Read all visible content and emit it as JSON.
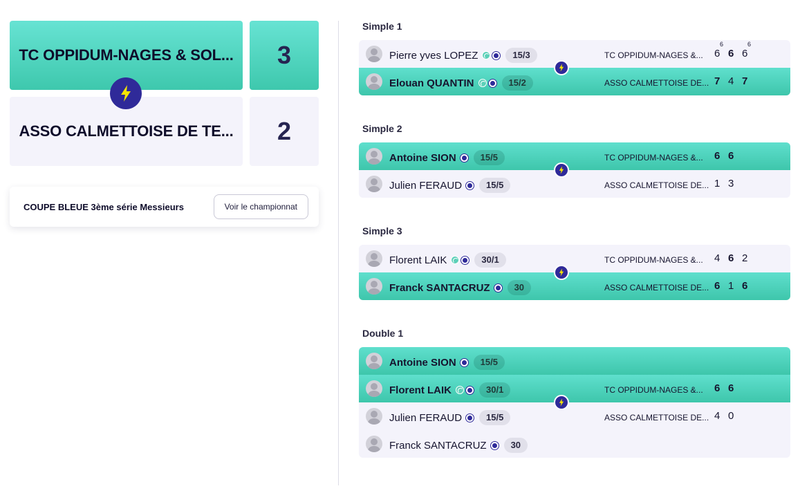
{
  "encounter": {
    "team1": {
      "name": "TC OPPIDUM-NAGES & SOL...",
      "score": "3"
    },
    "team2": {
      "name": "ASSO CALMETTOISE DE TE...",
      "score": "2"
    },
    "bolt_icon": "lightning-bolt-icon"
  },
  "championship": {
    "title": "COUPE BLEUE 3ème série Messieurs",
    "button_label": "Voir le championnat"
  },
  "colors": {
    "accent_green": "#4fd6be",
    "brand_indigo": "#2f2a99",
    "bolt_yellow": "#f5e400",
    "card_grey": "#f4f3fb"
  },
  "matches": [
    {
      "title": "Simple 1",
      "rows": [
        {
          "win": false,
          "name": "Pierre yves LOPEZ",
          "icons": [
            "tennis-ball-icon",
            "club-icon"
          ],
          "rank": "15/3",
          "club": "TC OPPIDUM-NAGES &...",
          "sets": [
            {
              "v": "6",
              "tb": "6",
              "won": false
            },
            {
              "v": "6",
              "tb": "",
              "won": true
            },
            {
              "v": "6",
              "tb": "6",
              "won": false
            }
          ]
        },
        {
          "win": true,
          "name": "Elouan QUANTIN",
          "icons": [
            "tennis-ball-icon",
            "club-icon"
          ],
          "rank": "15/2",
          "club": "ASSO CALMETTOISE DE...",
          "sets": [
            {
              "v": "7",
              "tb": "",
              "won": true
            },
            {
              "v": "4",
              "tb": "",
              "won": false
            },
            {
              "v": "7",
              "tb": "",
              "won": true
            }
          ]
        }
      ]
    },
    {
      "title": "Simple 2",
      "rows": [
        {
          "win": true,
          "name": "Antoine SION",
          "icons": [
            "club-icon"
          ],
          "rank": "15/5",
          "club": "TC OPPIDUM-NAGES &...",
          "sets": [
            {
              "v": "6",
              "tb": "",
              "won": true
            },
            {
              "v": "6",
              "tb": "",
              "won": true
            }
          ]
        },
        {
          "win": false,
          "name": "Julien FERAUD",
          "icons": [
            "club-icon"
          ],
          "rank": "15/5",
          "club": "ASSO CALMETTOISE DE...",
          "sets": [
            {
              "v": "1",
              "tb": "",
              "won": false
            },
            {
              "v": "3",
              "tb": "",
              "won": false
            }
          ]
        }
      ]
    },
    {
      "title": "Simple 3",
      "rows": [
        {
          "win": false,
          "name": "Florent LAIK",
          "icons": [
            "tennis-ball-icon",
            "club-icon"
          ],
          "rank": "30/1",
          "club": "TC OPPIDUM-NAGES &...",
          "sets": [
            {
              "v": "4",
              "tb": "",
              "won": false
            },
            {
              "v": "6",
              "tb": "",
              "won": true
            },
            {
              "v": "2",
              "tb": "",
              "won": false
            }
          ]
        },
        {
          "win": true,
          "name": "Franck SANTACRUZ",
          "icons": [
            "club-icon"
          ],
          "rank": "30",
          "club": "ASSO CALMETTOISE DE...",
          "sets": [
            {
              "v": "6",
              "tb": "",
              "won": true
            },
            {
              "v": "1",
              "tb": "",
              "won": false
            },
            {
              "v": "6",
              "tb": "",
              "won": true
            }
          ]
        }
      ]
    },
    {
      "title": "Double 1",
      "rows": [
        {
          "win": true,
          "name": "Antoine SION",
          "icons": [
            "club-icon"
          ],
          "rank": "15/5",
          "club": "",
          "sets": []
        },
        {
          "win": true,
          "name": "Florent LAIK",
          "icons": [
            "tennis-ball-icon",
            "club-icon"
          ],
          "rank": "30/1",
          "club": "TC OPPIDUM-NAGES &...",
          "sets": [
            {
              "v": "6",
              "tb": "",
              "won": true
            },
            {
              "v": "6",
              "tb": "",
              "won": true
            }
          ]
        },
        {
          "win": false,
          "name": "Julien FERAUD",
          "icons": [
            "club-icon"
          ],
          "rank": "15/5",
          "club": "ASSO CALMETTOISE DE...",
          "sets": [
            {
              "v": "4",
              "tb": "",
              "won": false
            },
            {
              "v": "0",
              "tb": "",
              "won": false
            }
          ]
        },
        {
          "win": false,
          "name": "Franck SANTACRUZ",
          "icons": [
            "club-icon"
          ],
          "rank": "30",
          "club": "",
          "sets": []
        }
      ]
    }
  ]
}
